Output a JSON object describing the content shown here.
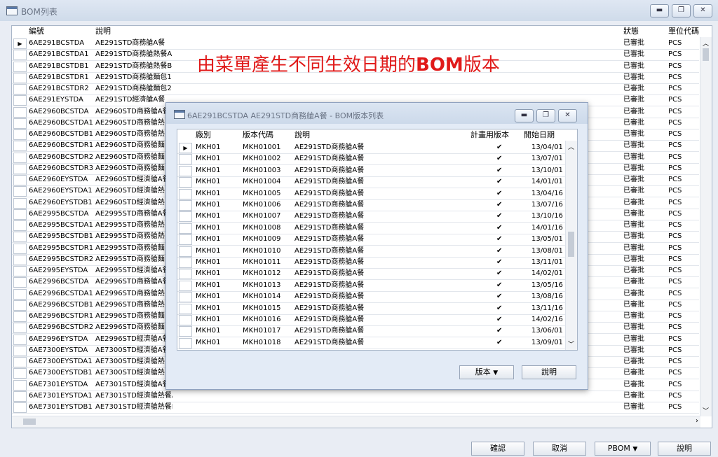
{
  "window": {
    "title": "BOM列表",
    "buttons": [
      "minimize",
      "restore",
      "close"
    ]
  },
  "overlay_text": {
    "prefix": "由菜單產生不同生效日期的",
    "bold": "BOM",
    "suffix": "版本"
  },
  "grid": {
    "columns": [
      "編號",
      "說明",
      "狀態",
      "單位代碼"
    ],
    "rows": [
      [
        "6AE291BCSTDA",
        "AE291STD商務艙A餐",
        "已審批",
        "PCS"
      ],
      [
        "6AE291BCSTDA1",
        "AE291STD商務艙熱餐A",
        "已審批",
        "PCS"
      ],
      [
        "6AE291BCSTDB1",
        "AE291STD商務艙熱餐B",
        "已審批",
        "PCS"
      ],
      [
        "6AE291BCSTDR1",
        "AE291STD商務艙麵包1",
        "已審批",
        "PCS"
      ],
      [
        "6AE291BCSTDR2",
        "AE291STD商務艙麵包2",
        "已審批",
        "PCS"
      ],
      [
        "6AE291EYSTDA",
        "AE291STD經濟艙A餐",
        "已審批",
        "PCS"
      ],
      [
        "6AE2960BCSTDA",
        "AE2960STD商務艙A餐",
        "已審批",
        "PCS"
      ],
      [
        "6AE2960BCSTDA1",
        "AE2960STD商務艙熱",
        "已審批",
        "PCS"
      ],
      [
        "6AE2960BCSTDB1",
        "AE2960STD商務艙熱",
        "已審批",
        "PCS"
      ],
      [
        "6AE2960BCSTDR1",
        "AE2960STD商務艙麵",
        "已審批",
        "PCS"
      ],
      [
        "6AE2960BCSTDR2",
        "AE2960STD商務艙麵",
        "已審批",
        "PCS"
      ],
      [
        "6AE2960BCSTDR3",
        "AE2960STD商務艙麵",
        "已審批",
        "PCS"
      ],
      [
        "6AE2960EYSTDA",
        "AE2960STD經濟艙A餐",
        "已審批",
        "PCS"
      ],
      [
        "6AE2960EYSTDA1",
        "AE2960STD經濟艙熱",
        "已審批",
        "PCS"
      ],
      [
        "6AE2960EYSTDB1",
        "AE2960STD經濟艙熱",
        "已審批",
        "PCS"
      ],
      [
        "6AE2995BCSTDA",
        "AE2995STD商務艙A餐",
        "已審批",
        "PCS"
      ],
      [
        "6AE2995BCSTDA1",
        "AE2995STD商務艙熱",
        "已審批",
        "PCS"
      ],
      [
        "6AE2995BCSTDB1",
        "AE2995STD商務艙熱",
        "已審批",
        "PCS"
      ],
      [
        "6AE2995BCSTDR1",
        "AE2995STD商務艙麵",
        "已審批",
        "PCS"
      ],
      [
        "6AE2995BCSTDR2",
        "AE2995STD商務艙麵",
        "已審批",
        "PCS"
      ],
      [
        "6AE2995EYSTDA",
        "AE2995STD經濟艙A餐",
        "已審批",
        "PCS"
      ],
      [
        "6AE2996BCSTDA",
        "AE2996STD商務艙A餐",
        "已審批",
        "PCS"
      ],
      [
        "6AE2996BCSTDA1",
        "AE2996STD商務艙熱",
        "已審批",
        "PCS"
      ],
      [
        "6AE2996BCSTDB1",
        "AE2996STD商務艙熱",
        "已審批",
        "PCS"
      ],
      [
        "6AE2996BCSTDR1",
        "AE2996STD商務艙麵",
        "已審批",
        "PCS"
      ],
      [
        "6AE2996BCSTDR2",
        "AE2996STD商務艙麵",
        "已審批",
        "PCS"
      ],
      [
        "6AE2996EYSTDA",
        "AE2996STD經濟艙A餐",
        "已審批",
        "PCS"
      ],
      [
        "6AE7300EYSTDA",
        "AE7300STD經濟艙A餐",
        "已審批",
        "PCS"
      ],
      [
        "6AE7300EYSTDA1",
        "AE7300STD經濟艙熱",
        "已審批",
        "PCS"
      ],
      [
        "6AE7300EYSTDB1",
        "AE7300STD經濟艙熱",
        "已審批",
        "PCS"
      ],
      [
        "6AE7301EYSTDA",
        "AE7301STD經濟艙A餐",
        "已審批",
        "PCS"
      ],
      [
        "6AE7301EYSTDA1",
        "AE7301STD經濟艙熱餐A",
        "已審批",
        "PCS"
      ],
      [
        "6AE7301EYSTDB1",
        "AE7301STD經濟艙熱餐B",
        "已審批",
        "PCS"
      ]
    ]
  },
  "footer_buttons": {
    "confirm": "確認",
    "cancel": "取消",
    "pbom": "PBOM",
    "explain": "說明"
  },
  "dialog": {
    "title": "6AE291BCSTDA AE291STD商務艙A餐 - BOM版本列表",
    "columns": [
      "廠別",
      "版本代碼",
      "說明",
      "計畫用版本",
      "開始日期"
    ],
    "rows": [
      [
        "MKH01",
        "MKH01001",
        "AE291STD商務艙A餐",
        "✔",
        "13/04/01"
      ],
      [
        "MKH01",
        "MKH01002",
        "AE291STD商務艙A餐",
        "✔",
        "13/07/01"
      ],
      [
        "MKH01",
        "MKH01003",
        "AE291STD商務艙A餐",
        "✔",
        "13/10/01"
      ],
      [
        "MKH01",
        "MKH01004",
        "AE291STD商務艙A餐",
        "✔",
        "14/01/01"
      ],
      [
        "MKH01",
        "MKH01005",
        "AE291STD商務艙A餐",
        "✔",
        "13/04/16"
      ],
      [
        "MKH01",
        "MKH01006",
        "AE291STD商務艙A餐",
        "✔",
        "13/07/16"
      ],
      [
        "MKH01",
        "MKH01007",
        "AE291STD商務艙A餐",
        "✔",
        "13/10/16"
      ],
      [
        "MKH01",
        "MKH01008",
        "AE291STD商務艙A餐",
        "✔",
        "14/01/16"
      ],
      [
        "MKH01",
        "MKH01009",
        "AE291STD商務艙A餐",
        "✔",
        "13/05/01"
      ],
      [
        "MKH01",
        "MKH01010",
        "AE291STD商務艙A餐",
        "✔",
        "13/08/01"
      ],
      [
        "MKH01",
        "MKH01011",
        "AE291STD商務艙A餐",
        "✔",
        "13/11/01"
      ],
      [
        "MKH01",
        "MKH01012",
        "AE291STD商務艙A餐",
        "✔",
        "14/02/01"
      ],
      [
        "MKH01",
        "MKH01013",
        "AE291STD商務艙A餐",
        "✔",
        "13/05/16"
      ],
      [
        "MKH01",
        "MKH01014",
        "AE291STD商務艙A餐",
        "✔",
        "13/08/16"
      ],
      [
        "MKH01",
        "MKH01015",
        "AE291STD商務艙A餐",
        "✔",
        "13/11/16"
      ],
      [
        "MKH01",
        "MKH01016",
        "AE291STD商務艙A餐",
        "✔",
        "14/02/16"
      ],
      [
        "MKH01",
        "MKH01017",
        "AE291STD商務艙A餐",
        "✔",
        "13/06/01"
      ],
      [
        "MKH01",
        "MKH01018",
        "AE291STD商務艙A餐",
        "✔",
        "13/09/01"
      ]
    ],
    "buttons": {
      "version": "版本",
      "explain": "說明"
    }
  }
}
